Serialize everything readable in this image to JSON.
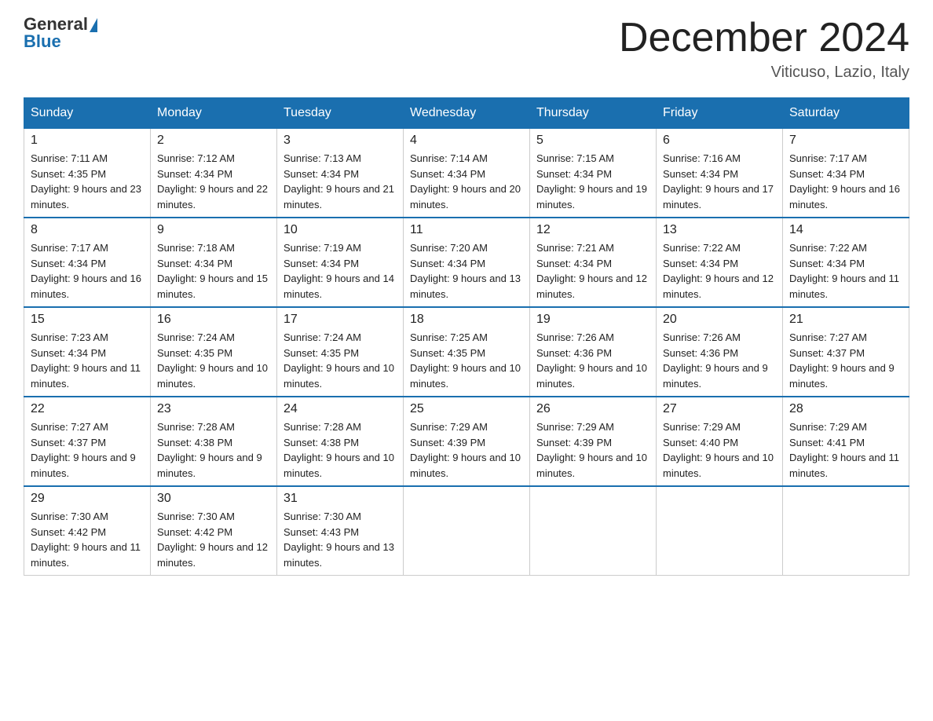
{
  "header": {
    "logo_general": "General",
    "logo_blue": "Blue",
    "month_title": "December 2024",
    "location": "Viticuso, Lazio, Italy"
  },
  "days_of_week": [
    "Sunday",
    "Monday",
    "Tuesday",
    "Wednesday",
    "Thursday",
    "Friday",
    "Saturday"
  ],
  "weeks": [
    [
      {
        "day": "1",
        "sunrise": "7:11 AM",
        "sunset": "4:35 PM",
        "daylight": "9 hours and 23 minutes."
      },
      {
        "day": "2",
        "sunrise": "7:12 AM",
        "sunset": "4:34 PM",
        "daylight": "9 hours and 22 minutes."
      },
      {
        "day": "3",
        "sunrise": "7:13 AM",
        "sunset": "4:34 PM",
        "daylight": "9 hours and 21 minutes."
      },
      {
        "day": "4",
        "sunrise": "7:14 AM",
        "sunset": "4:34 PM",
        "daylight": "9 hours and 20 minutes."
      },
      {
        "day": "5",
        "sunrise": "7:15 AM",
        "sunset": "4:34 PM",
        "daylight": "9 hours and 19 minutes."
      },
      {
        "day": "6",
        "sunrise": "7:16 AM",
        "sunset": "4:34 PM",
        "daylight": "9 hours and 17 minutes."
      },
      {
        "day": "7",
        "sunrise": "7:17 AM",
        "sunset": "4:34 PM",
        "daylight": "9 hours and 16 minutes."
      }
    ],
    [
      {
        "day": "8",
        "sunrise": "7:17 AM",
        "sunset": "4:34 PM",
        "daylight": "9 hours and 16 minutes."
      },
      {
        "day": "9",
        "sunrise": "7:18 AM",
        "sunset": "4:34 PM",
        "daylight": "9 hours and 15 minutes."
      },
      {
        "day": "10",
        "sunrise": "7:19 AM",
        "sunset": "4:34 PM",
        "daylight": "9 hours and 14 minutes."
      },
      {
        "day": "11",
        "sunrise": "7:20 AM",
        "sunset": "4:34 PM",
        "daylight": "9 hours and 13 minutes."
      },
      {
        "day": "12",
        "sunrise": "7:21 AM",
        "sunset": "4:34 PM",
        "daylight": "9 hours and 12 minutes."
      },
      {
        "day": "13",
        "sunrise": "7:22 AM",
        "sunset": "4:34 PM",
        "daylight": "9 hours and 12 minutes."
      },
      {
        "day": "14",
        "sunrise": "7:22 AM",
        "sunset": "4:34 PM",
        "daylight": "9 hours and 11 minutes."
      }
    ],
    [
      {
        "day": "15",
        "sunrise": "7:23 AM",
        "sunset": "4:34 PM",
        "daylight": "9 hours and 11 minutes."
      },
      {
        "day": "16",
        "sunrise": "7:24 AM",
        "sunset": "4:35 PM",
        "daylight": "9 hours and 10 minutes."
      },
      {
        "day": "17",
        "sunrise": "7:24 AM",
        "sunset": "4:35 PM",
        "daylight": "9 hours and 10 minutes."
      },
      {
        "day": "18",
        "sunrise": "7:25 AM",
        "sunset": "4:35 PM",
        "daylight": "9 hours and 10 minutes."
      },
      {
        "day": "19",
        "sunrise": "7:26 AM",
        "sunset": "4:36 PM",
        "daylight": "9 hours and 10 minutes."
      },
      {
        "day": "20",
        "sunrise": "7:26 AM",
        "sunset": "4:36 PM",
        "daylight": "9 hours and 9 minutes."
      },
      {
        "day": "21",
        "sunrise": "7:27 AM",
        "sunset": "4:37 PM",
        "daylight": "9 hours and 9 minutes."
      }
    ],
    [
      {
        "day": "22",
        "sunrise": "7:27 AM",
        "sunset": "4:37 PM",
        "daylight": "9 hours and 9 minutes."
      },
      {
        "day": "23",
        "sunrise": "7:28 AM",
        "sunset": "4:38 PM",
        "daylight": "9 hours and 9 minutes."
      },
      {
        "day": "24",
        "sunrise": "7:28 AM",
        "sunset": "4:38 PM",
        "daylight": "9 hours and 10 minutes."
      },
      {
        "day": "25",
        "sunrise": "7:29 AM",
        "sunset": "4:39 PM",
        "daylight": "9 hours and 10 minutes."
      },
      {
        "day": "26",
        "sunrise": "7:29 AM",
        "sunset": "4:39 PM",
        "daylight": "9 hours and 10 minutes."
      },
      {
        "day": "27",
        "sunrise": "7:29 AM",
        "sunset": "4:40 PM",
        "daylight": "9 hours and 10 minutes."
      },
      {
        "day": "28",
        "sunrise": "7:29 AM",
        "sunset": "4:41 PM",
        "daylight": "9 hours and 11 minutes."
      }
    ],
    [
      {
        "day": "29",
        "sunrise": "7:30 AM",
        "sunset": "4:42 PM",
        "daylight": "9 hours and 11 minutes."
      },
      {
        "day": "30",
        "sunrise": "7:30 AM",
        "sunset": "4:42 PM",
        "daylight": "9 hours and 12 minutes."
      },
      {
        "day": "31",
        "sunrise": "7:30 AM",
        "sunset": "4:43 PM",
        "daylight": "9 hours and 13 minutes."
      },
      null,
      null,
      null,
      null
    ]
  ],
  "labels": {
    "sunrise": "Sunrise:",
    "sunset": "Sunset:",
    "daylight": "Daylight:"
  },
  "accent_color": "#1a6faf"
}
